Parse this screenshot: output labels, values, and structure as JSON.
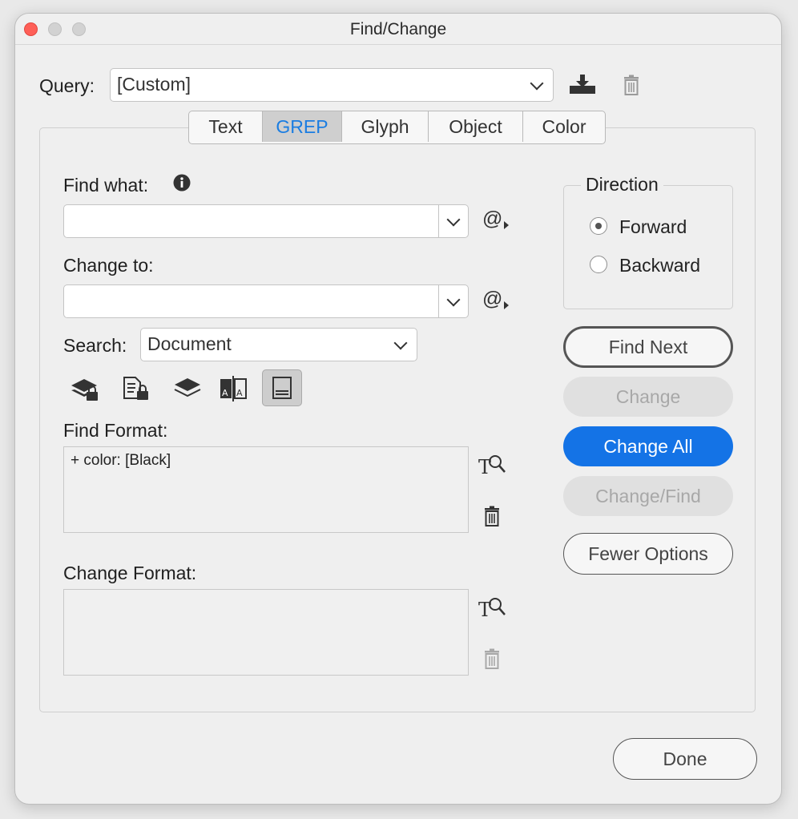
{
  "window": {
    "title": "Find/Change"
  },
  "query": {
    "label": "Query:",
    "value": "[Custom]"
  },
  "tabs": [
    {
      "label": "Text",
      "active": false
    },
    {
      "label": "GREP",
      "active": true
    },
    {
      "label": "Glyph",
      "active": false
    },
    {
      "label": "Object",
      "active": false
    },
    {
      "label": "Color",
      "active": false
    }
  ],
  "find_what": {
    "label": "Find what:",
    "value": ""
  },
  "change_to": {
    "label": "Change to:",
    "value": ""
  },
  "search": {
    "label": "Search:",
    "value": "Document"
  },
  "search_options_icons": [
    "locked-layers-icon",
    "locked-stories-icon",
    "hidden-layers-icon",
    "master-pages-icon",
    "footnotes-icon"
  ],
  "find_format": {
    "label": "Find Format:",
    "value": "+ color: [Black]"
  },
  "change_format": {
    "label": "Change Format:",
    "value": ""
  },
  "direction": {
    "label": "Direction",
    "options": [
      {
        "label": "Forward",
        "selected": true
      },
      {
        "label": "Backward",
        "selected": false
      }
    ]
  },
  "buttons": {
    "find_next": "Find Next",
    "change": "Change",
    "change_all": "Change All",
    "change_find": "Change/Find",
    "fewer_options": "Fewer Options",
    "done": "Done"
  },
  "colors": {
    "accent": "#1473e6",
    "active_tab_text": "#1a7de2",
    "close": "#fe5f57"
  }
}
